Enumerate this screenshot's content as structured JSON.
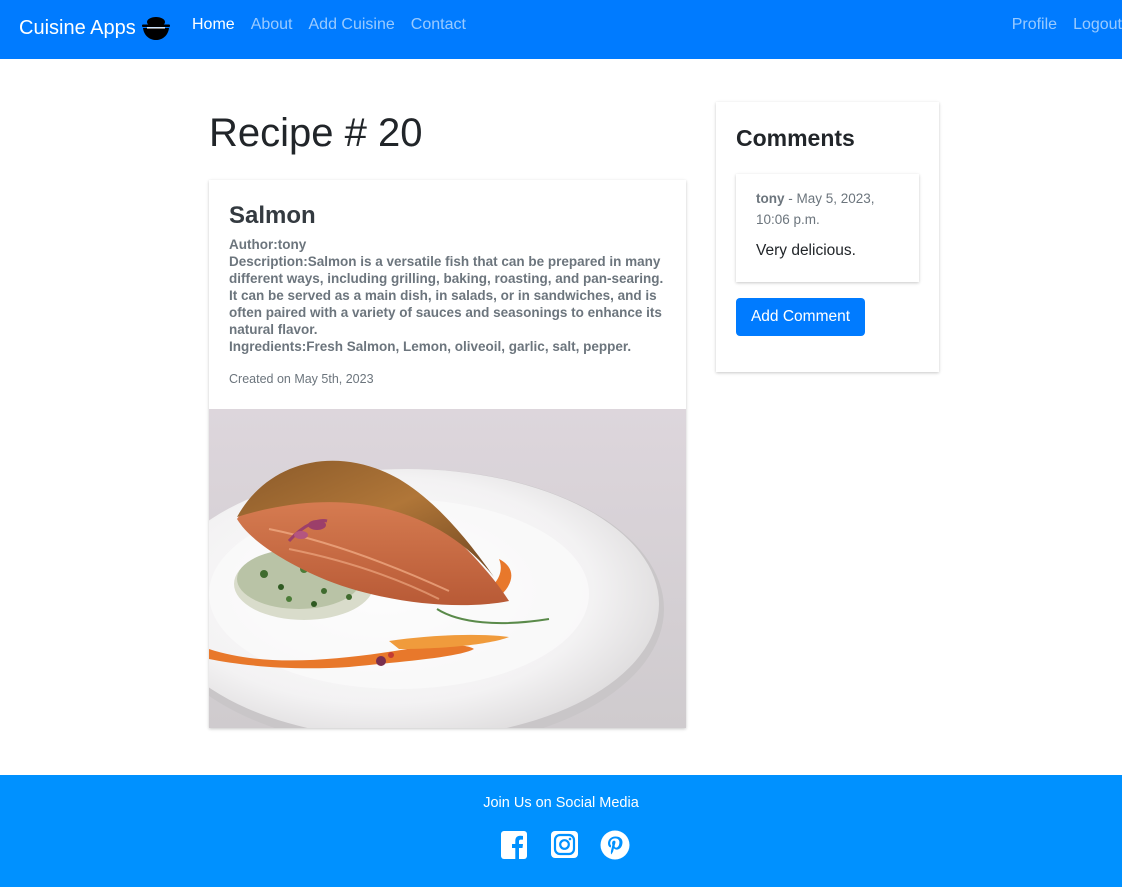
{
  "navbar": {
    "brand": "Cuisine Apps",
    "links": [
      "Home",
      "About",
      "Add Cuisine",
      "Contact"
    ],
    "right_links": [
      "Profile",
      "Logout"
    ],
    "colors": {
      "background": "#007bff",
      "active": "#ffffff",
      "inactive": "rgba(255,255,255,0.6)"
    }
  },
  "page": {
    "title": "Recipe # 20"
  },
  "recipe": {
    "name": "Salmon",
    "author": "Author:tony",
    "description": "Description:Salmon is a versatile fish that can be prepared in many different ways, including grilling, baking, roasting, and pan-searing. It can be served as a main dish, in salads, or in sandwiches, and is often paired with a variety of sauces and seasonings to enhance its natural flavor.",
    "ingredients": "Ingredients:Fresh Salmon, Lemon, oliveoil, garlic, salt, pepper.",
    "created": "Created on May 5th, 2023"
  },
  "comments": {
    "title": "Comments",
    "items": [
      {
        "author": "tony",
        "separator": " - ",
        "date": "May 5, 2023, 10:06 p.m.",
        "text": "Very delicious."
      }
    ],
    "add_button": "Add Comment"
  },
  "footer": {
    "text": "Join Us on Social Media",
    "social_icons": [
      "facebook-icon",
      "instagram-icon",
      "pinterest-icon"
    ],
    "background": "#0091ff"
  }
}
